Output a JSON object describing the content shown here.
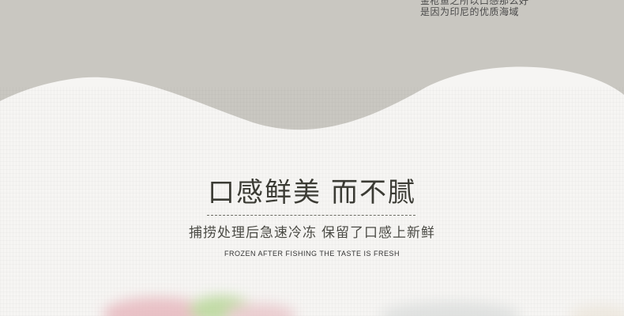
{
  "header": {
    "caption_lines": [
      "金枪鱼之所以口感那么好",
      "是因为印尼的优质海域"
    ]
  },
  "main": {
    "headline_part1": "口感鲜美",
    "headline_part2": "而不腻",
    "subline_part1": "捕捞处理后急速冷冻",
    "subline_part2": "保留了口感上新鲜",
    "english_caption": "FROZEN AFTER FISHING THE TASTE IS FRESH"
  },
  "colors": {
    "band_gray": "#c9c7c1",
    "background": "#f6f5f3",
    "headline_text": "#3b3b34"
  },
  "images": {
    "bottom_photo": "blurred-tuna-sashimi-image"
  }
}
